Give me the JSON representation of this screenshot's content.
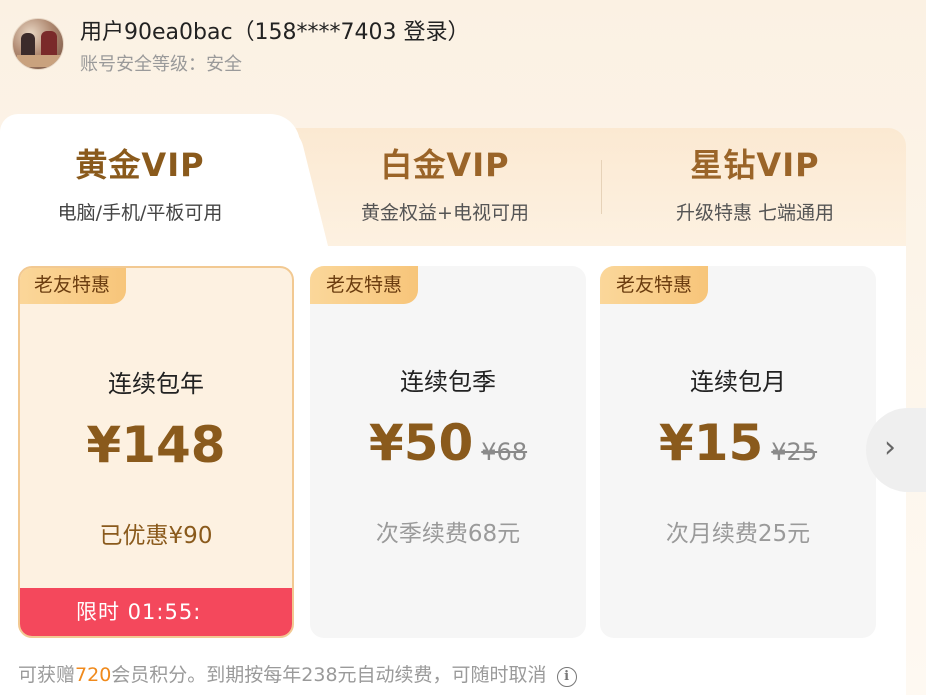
{
  "user": {
    "name": "用户90ea0bac（158****7403 登录）",
    "security_level": "账号安全等级：安全"
  },
  "tabs": [
    {
      "title": "黄金VIP",
      "subtitle": "电脑/手机/平板可用",
      "active": true
    },
    {
      "title": "白金VIP",
      "subtitle": "黄金权益+电视可用",
      "active": false
    },
    {
      "title": "星钻VIP",
      "subtitle": "升级特惠 七端通用",
      "active": false
    }
  ],
  "plans": [
    {
      "badge": "老友特惠",
      "name": "连续包年",
      "price": "¥148",
      "original": "",
      "note": "已优惠¥90",
      "timer": "限时 01:55:",
      "selected": true
    },
    {
      "badge": "老友特惠",
      "name": "连续包季",
      "price": "¥50",
      "original": "¥68",
      "note": "次季续费68元",
      "selected": false
    },
    {
      "badge": "老友特惠",
      "name": "连续包月",
      "price": "¥15",
      "original": "¥25",
      "note": "次月续费25元",
      "selected": false
    }
  ],
  "footer": {
    "prefix": "可获赠",
    "points": "720",
    "suffix": "会员积分。到期按每年238元自动续费，可随时取消"
  },
  "icons": {
    "next": "chevron-right-icon",
    "info": "info-icon"
  },
  "colors": {
    "gold_text": "#8a5a1c",
    "badge": "#f7c57a",
    "timer_bar": "#f4485c",
    "highlight": "#f08a1c"
  }
}
